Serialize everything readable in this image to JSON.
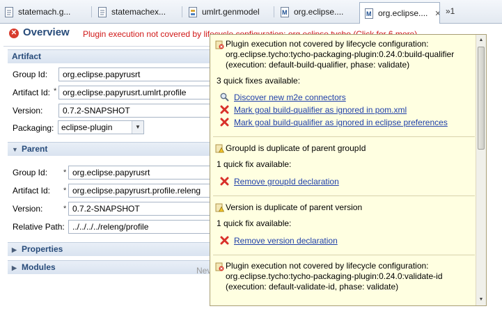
{
  "tabs": [
    {
      "label": "statemach.g...",
      "icon": "file-icon"
    },
    {
      "label": "statemachex...",
      "icon": "file-icon"
    },
    {
      "label": "umlrt.genmodel",
      "icon": "genmodel-icon"
    },
    {
      "label": "org.eclipse....",
      "icon": "maven-icon"
    },
    {
      "label": "org.eclipse....",
      "icon": "maven-icon",
      "active": true,
      "close": "✕"
    }
  ],
  "tab_overflow": "»1",
  "header": {
    "title": "Overview",
    "message": "Plugin execution not covered by lifecycle configuration: org.eclipse.tycho (Click for 6 more)"
  },
  "artifact": {
    "section_label": "Artifact",
    "group_id_label": "Group Id:",
    "group_id_value": "org.eclipse.papyrusrt",
    "artifact_id_label": "Artifact Id:",
    "artifact_id_value": "org.eclipse.papyrusrt.umlrt.profile",
    "version_label": "Version:",
    "version_value": "0.7.2-SNAPSHOT",
    "packaging_label": "Packaging:",
    "packaging_value": "eclipse-plugin",
    "required_marker": "*"
  },
  "parent": {
    "section_label": "Parent",
    "group_id_label": "Group Id:",
    "group_id_value": "org.eclipse.papyrusrt",
    "artifact_id_label": "Artifact Id:",
    "artifact_id_value": "org.eclipse.papyrusrt.profile.releng",
    "version_label": "Version:",
    "version_value": "0.7.2-SNAPSHOT",
    "relative_path_label": "Relative Path:",
    "relative_path_value": "../../../../releng/profile",
    "required_marker": "*"
  },
  "properties": {
    "section_label": "Properties"
  },
  "modules": {
    "section_label": "Modules",
    "faded_text": "Nev"
  },
  "popup": {
    "problems": [
      {
        "lines": [
          "Plugin execution not covered by lifecycle configuration:",
          "org.eclipse.tycho:tycho-packaging-plugin:0.24.0:build-qualifier",
          "(execution: default-build-qualifier, phase: validate)"
        ],
        "fix_count": "3 quick fixes available:",
        "fixes": [
          {
            "label": "Discover new m2e connectors",
            "icon": "search-icon"
          },
          {
            "label": "Mark goal build-qualifier as ignored in pom.xml",
            "icon": "error-x-icon"
          },
          {
            "label": "Mark goal build-qualifier as ignored in eclipse preferences",
            "icon": "error-x-icon"
          }
        ]
      },
      {
        "lines": [
          "GroupId is duplicate of parent groupId"
        ],
        "fix_count": "1 quick fix available:",
        "fixes": [
          {
            "label": "Remove groupId declaration",
            "icon": "error-x-icon"
          }
        ]
      },
      {
        "lines": [
          "Version is duplicate of parent version"
        ],
        "fix_count": "1 quick fix available:",
        "fixes": [
          {
            "label": "Remove version declaration",
            "icon": "error-x-icon"
          }
        ]
      },
      {
        "lines": [
          "Plugin execution not covered by lifecycle configuration:",
          "org.eclipse.tycho:tycho-packaging-plugin:0.24.0:validate-id",
          "(execution: default-validate-id, phase: validate)"
        ]
      }
    ]
  },
  "colors": {
    "title": "#274b7a",
    "error_text": "#d01818",
    "popup_background": "#ffffe1",
    "link": "#1f3fa9"
  }
}
